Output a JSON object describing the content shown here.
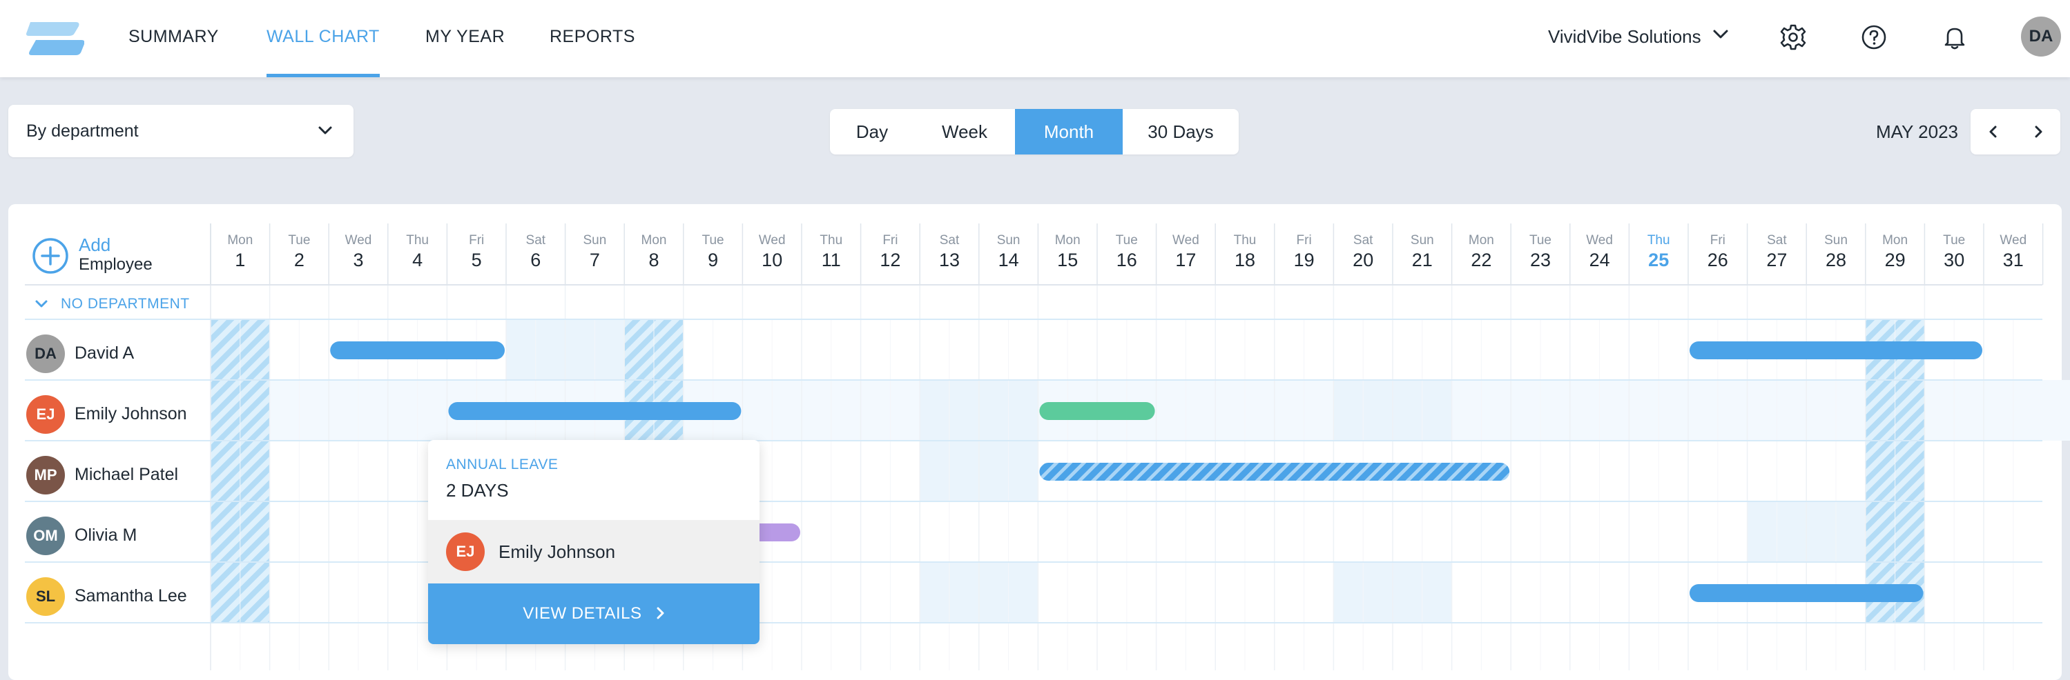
{
  "nav": {
    "items": [
      {
        "label": "SUMMARY",
        "active": false
      },
      {
        "label": "WALL CHART",
        "active": true
      },
      {
        "label": "MY YEAR",
        "active": false
      },
      {
        "label": "REPORTS",
        "active": false
      }
    ],
    "company": "VividVibe Solutions",
    "user_initials": "DA",
    "icons": [
      "settings-gear-icon",
      "help-circle-icon",
      "bell-icon"
    ]
  },
  "toolbar": {
    "group_by": "By department",
    "views": [
      {
        "label": "Day",
        "active": false
      },
      {
        "label": "Week",
        "active": false
      },
      {
        "label": "Month",
        "active": true
      },
      {
        "label": "30 Days",
        "active": false
      }
    ],
    "period": "MAY 2023"
  },
  "calendar": {
    "today": 25,
    "days": [
      {
        "dow": "Mon",
        "day": 1
      },
      {
        "dow": "Tue",
        "day": 2
      },
      {
        "dow": "Wed",
        "day": 3
      },
      {
        "dow": "Thu",
        "day": 4
      },
      {
        "dow": "Fri",
        "day": 5
      },
      {
        "dow": "Sat",
        "day": 6
      },
      {
        "dow": "Sun",
        "day": 7
      },
      {
        "dow": "Mon",
        "day": 8
      },
      {
        "dow": "Tue",
        "day": 9
      },
      {
        "dow": "Wed",
        "day": 10
      },
      {
        "dow": "Thu",
        "day": 11
      },
      {
        "dow": "Fri",
        "day": 12
      },
      {
        "dow": "Sat",
        "day": 13
      },
      {
        "dow": "Sun",
        "day": 14
      },
      {
        "dow": "Mon",
        "day": 15
      },
      {
        "dow": "Tue",
        "day": 16
      },
      {
        "dow": "Wed",
        "day": 17
      },
      {
        "dow": "Thu",
        "day": 18
      },
      {
        "dow": "Fri",
        "day": 19
      },
      {
        "dow": "Sat",
        "day": 20
      },
      {
        "dow": "Sun",
        "day": 21
      },
      {
        "dow": "Mon",
        "day": 22
      },
      {
        "dow": "Tue",
        "day": 23
      },
      {
        "dow": "Wed",
        "day": 24
      },
      {
        "dow": "Thu",
        "day": 25
      },
      {
        "dow": "Fri",
        "day": 26
      },
      {
        "dow": "Sat",
        "day": 27
      },
      {
        "dow": "Sun",
        "day": 28
      },
      {
        "dow": "Mon",
        "day": 29
      },
      {
        "dow": "Tue",
        "day": 30
      },
      {
        "dow": "Wed",
        "day": 31
      }
    ],
    "holidays": [
      1,
      8,
      29
    ],
    "add_label": "Add",
    "add_sub": "Employee",
    "department": "NO DEPARTMENT",
    "employees": [
      {
        "initials": "DA",
        "name": "David A",
        "color": "#9e9e9e",
        "text": "#1f2933",
        "weekends": [
          6,
          7
        ],
        "leaves": [
          {
            "start": 3,
            "end": 5,
            "type": "annual"
          },
          {
            "start": 26,
            "end": 30,
            "type": "annual"
          }
        ]
      },
      {
        "initials": "EJ",
        "name": "Emily Johnson",
        "color": "#e8603c",
        "text": "#ffffff",
        "weekends": [
          13,
          14,
          20,
          21
        ],
        "leaves": [
          {
            "start": 5,
            "end": 9,
            "type": "annual"
          },
          {
            "start": 15,
            "end": 16,
            "type": "other"
          }
        ]
      },
      {
        "initials": "MP",
        "name": "Michael Patel",
        "color": "#7a5548",
        "text": "#ffffff",
        "weekends": [
          13,
          14
        ],
        "leaves": [
          {
            "start": 15,
            "end": 22,
            "type": "pending"
          }
        ]
      },
      {
        "initials": "OM",
        "name": "Olivia M",
        "color": "#607d8b",
        "text": "#ffffff",
        "weekends": [
          27,
          28
        ],
        "leaves": [
          {
            "start": 9,
            "end": 10,
            "type": "unpaid"
          }
        ]
      },
      {
        "initials": "SL",
        "name": "Samantha Lee",
        "color": "#f5c242",
        "text": "#1f2933",
        "weekends": [
          13,
          14,
          20,
          21
        ],
        "leaves": [
          {
            "start": 26,
            "end": 29,
            "type": "annual"
          }
        ]
      }
    ],
    "leave_colors": {
      "annual": "#4ba3e8",
      "other": "#5ccb9c",
      "unpaid": "#b89ae6",
      "pending": "#4ba3e8"
    }
  },
  "popover": {
    "type": "ANNUAL LEAVE",
    "duration": "2 DAYS",
    "initials": "EJ",
    "name": "Emily Johnson",
    "button": "VIEW DETAILS"
  }
}
